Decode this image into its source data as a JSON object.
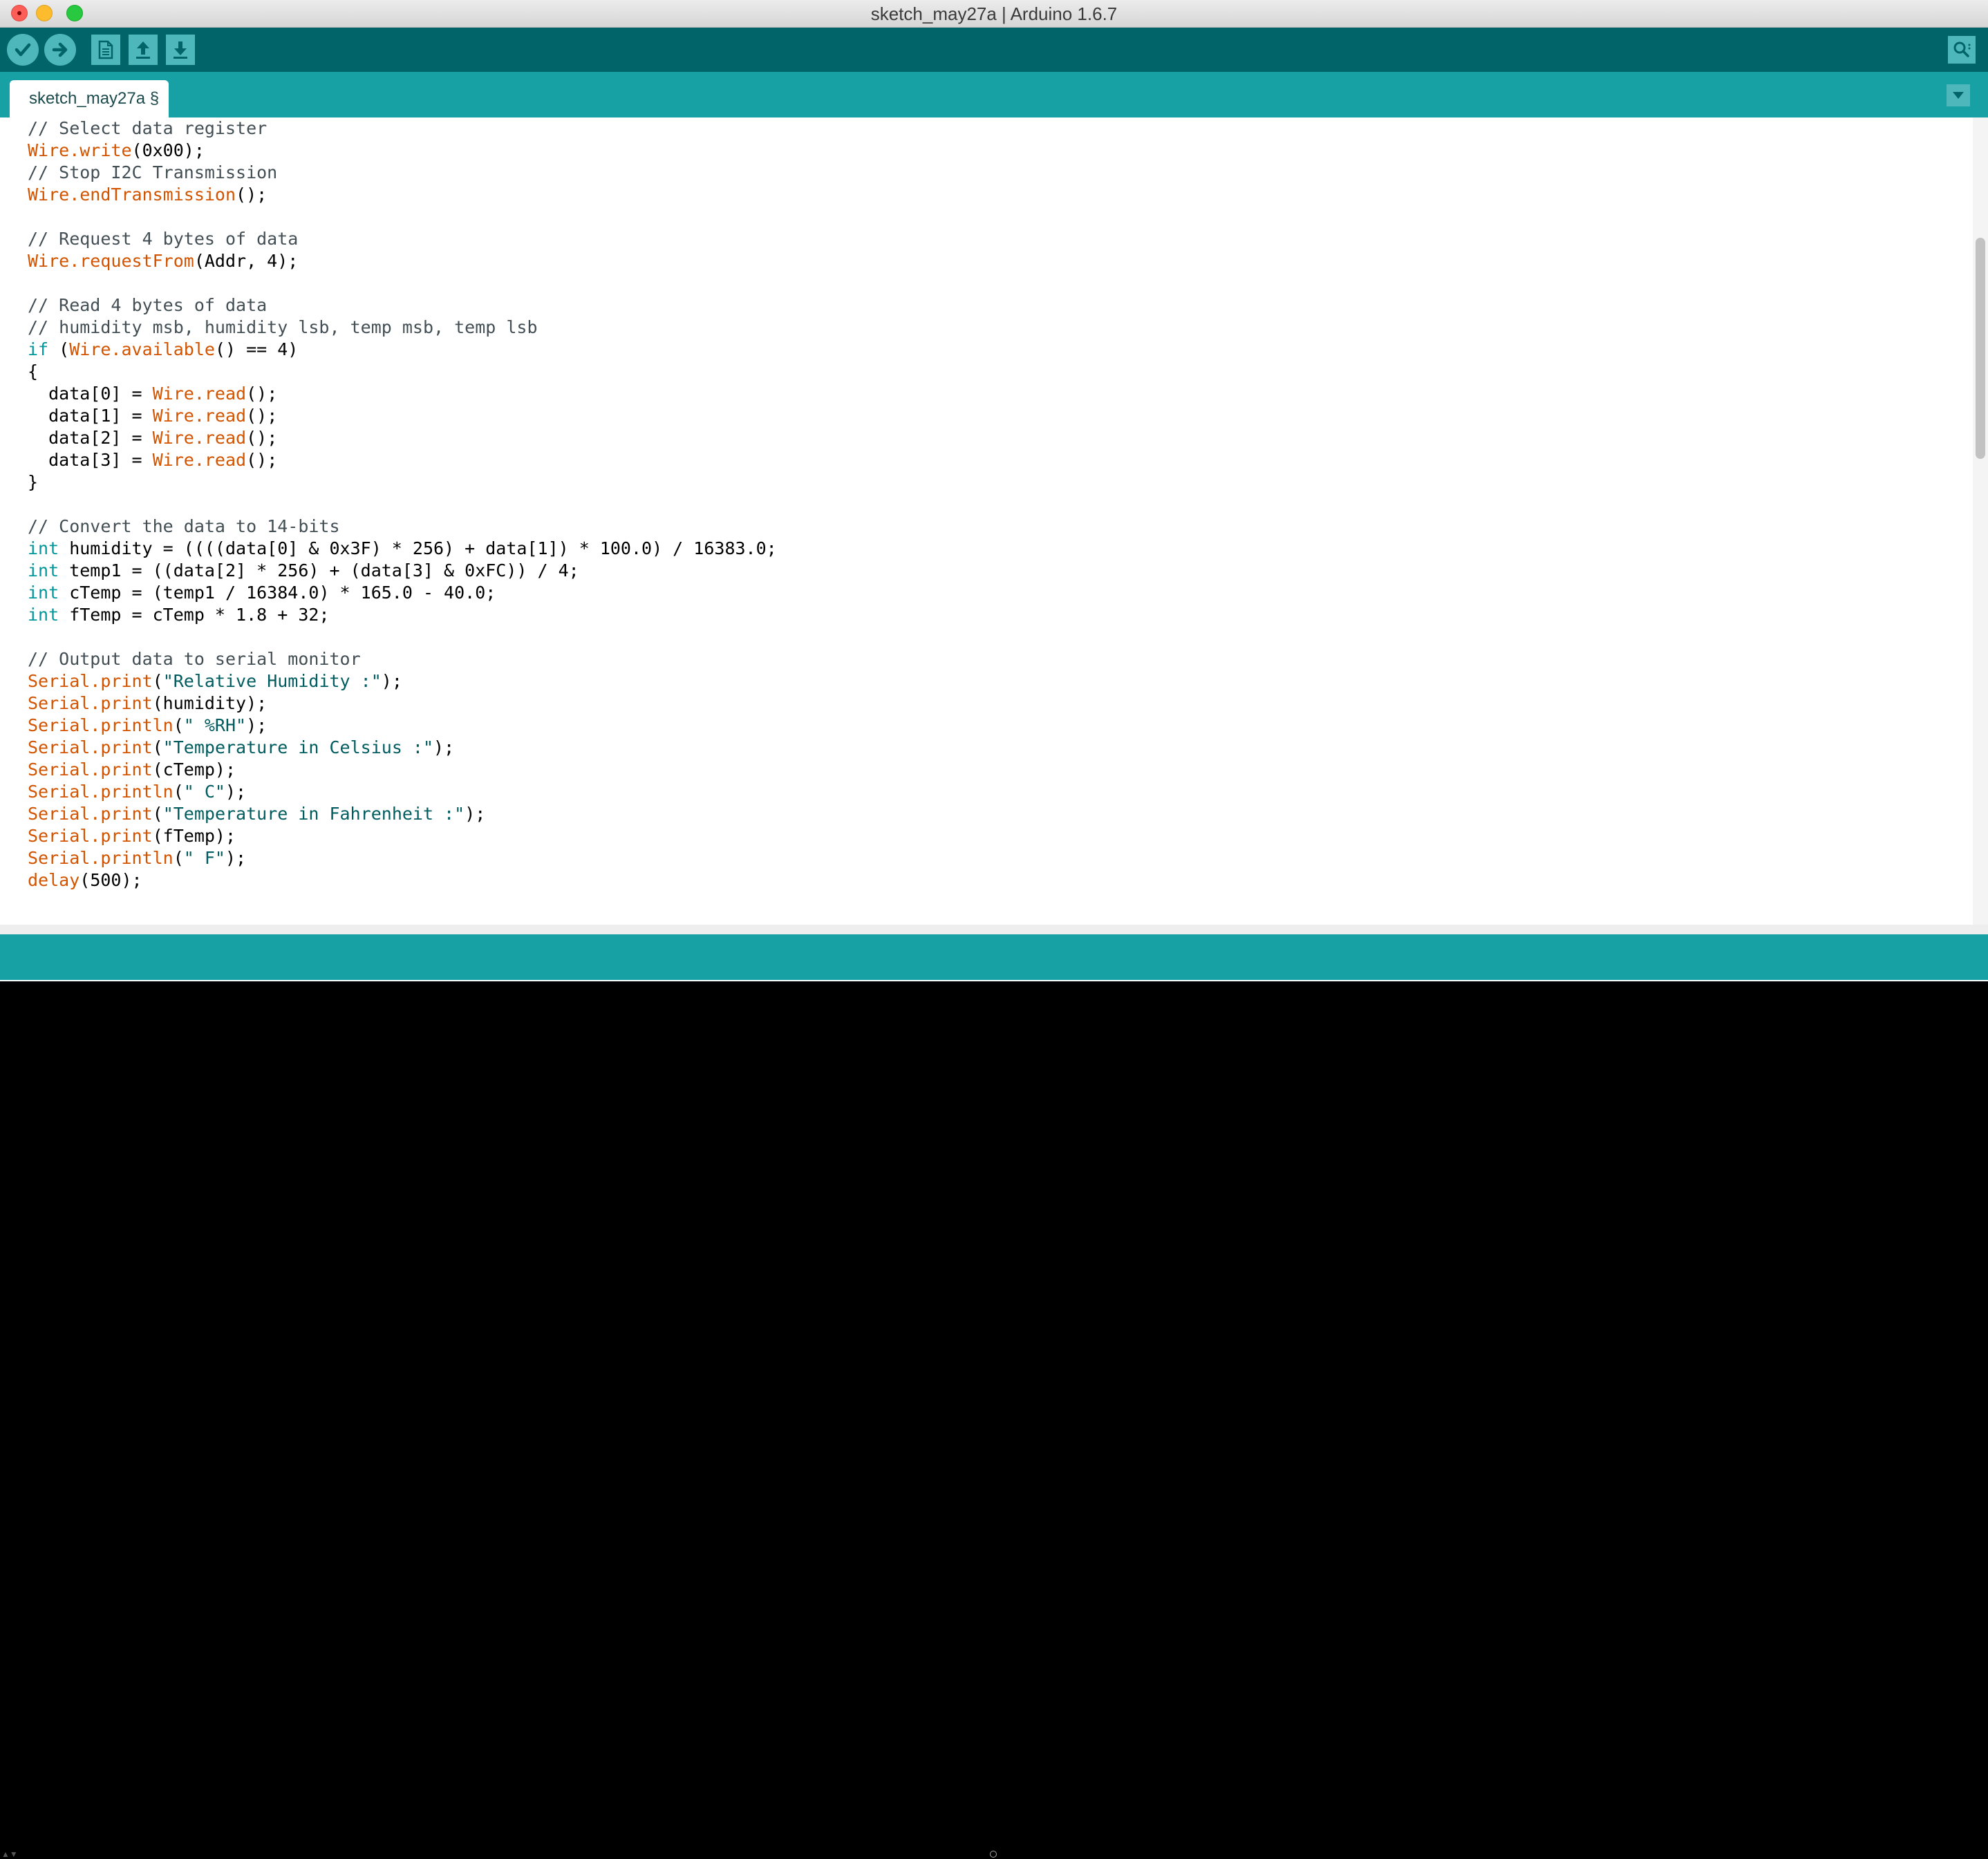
{
  "window": {
    "title": "sketch_may27a | Arduino 1.6.7"
  },
  "tabs": [
    {
      "label": "sketch_may27a §"
    }
  ],
  "toolbar": {
    "buttons": [
      {
        "name": "verify-button",
        "icon": "checkmark-icon"
      },
      {
        "name": "upload-button",
        "icon": "arrow-right-icon"
      },
      {
        "name": "new-button",
        "icon": "document-icon"
      },
      {
        "name": "open-button",
        "icon": "arrow-up-icon"
      },
      {
        "name": "save-button",
        "icon": "arrow-down-icon"
      }
    ],
    "serial_monitor_icon": "magnifier-icon"
  },
  "colors": {
    "toolbar": "#006468",
    "tabbar": "#17a1a5",
    "button": "#4db7bb",
    "comment": "#434f54",
    "function": "#d35400",
    "keyword": "#00979c",
    "string": "#005c5f"
  },
  "code": [
    [
      [
        "c",
        "// Select data register"
      ]
    ],
    [
      [
        "f",
        "Wire.write"
      ],
      [
        "p",
        "(0x00);"
      ]
    ],
    [
      [
        "c",
        "// Stop I2C Transmission"
      ]
    ],
    [
      [
        "f",
        "Wire.endTransmission"
      ],
      [
        "p",
        "();"
      ]
    ],
    [],
    [
      [
        "c",
        "// Request 4 bytes of data"
      ]
    ],
    [
      [
        "f",
        "Wire.requestFrom"
      ],
      [
        "p",
        "(Addr, 4);"
      ]
    ],
    [],
    [
      [
        "c",
        "// Read 4 bytes of data"
      ]
    ],
    [
      [
        "c",
        "// humidity msb, humidity lsb, temp msb, temp lsb"
      ]
    ],
    [
      [
        "k",
        "if"
      ],
      [
        "p",
        " ("
      ],
      [
        "f",
        "Wire.available"
      ],
      [
        "p",
        "() == 4)"
      ]
    ],
    [
      [
        "p",
        "{"
      ]
    ],
    [
      [
        "p",
        "  data[0] = "
      ],
      [
        "f",
        "Wire.read"
      ],
      [
        "p",
        "();"
      ]
    ],
    [
      [
        "p",
        "  data[1] = "
      ],
      [
        "f",
        "Wire.read"
      ],
      [
        "p",
        "();"
      ]
    ],
    [
      [
        "p",
        "  data[2] = "
      ],
      [
        "f",
        "Wire.read"
      ],
      [
        "p",
        "();"
      ]
    ],
    [
      [
        "p",
        "  data[3] = "
      ],
      [
        "f",
        "Wire.read"
      ],
      [
        "p",
        "();"
      ]
    ],
    [
      [
        "p",
        "}"
      ]
    ],
    [],
    [
      [
        "c",
        "// Convert the data to 14-bits"
      ]
    ],
    [
      [
        "k",
        "int"
      ],
      [
        "p",
        " humidity = ((((data[0] & 0x3F) * 256) + data[1]) * 100.0) / 16383.0;"
      ]
    ],
    [
      [
        "k",
        "int"
      ],
      [
        "p",
        " temp1 = ((data[2] * 256) + (data[3] & 0xFC)) / 4;"
      ]
    ],
    [
      [
        "k",
        "int"
      ],
      [
        "p",
        " cTemp = (temp1 / 16384.0) * 165.0 - 40.0;"
      ]
    ],
    [
      [
        "k",
        "int"
      ],
      [
        "p",
        " fTemp = cTemp * 1.8 + 32;"
      ]
    ],
    [],
    [
      [
        "c",
        "// Output data to serial monitor"
      ]
    ],
    [
      [
        "f",
        "Serial.print"
      ],
      [
        "p",
        "("
      ],
      [
        "s",
        "\"Relative Humidity :\""
      ],
      [
        "p",
        ");"
      ]
    ],
    [
      [
        "f",
        "Serial.print"
      ],
      [
        "p",
        "(humidity);"
      ]
    ],
    [
      [
        "f",
        "Serial.println"
      ],
      [
        "p",
        "("
      ],
      [
        "s",
        "\" %RH\""
      ],
      [
        "p",
        ");"
      ]
    ],
    [
      [
        "f",
        "Serial.print"
      ],
      [
        "p",
        "("
      ],
      [
        "s",
        "\"Temperature in Celsius :\""
      ],
      [
        "p",
        ");"
      ]
    ],
    [
      [
        "f",
        "Serial.print"
      ],
      [
        "p",
        "(cTemp);"
      ]
    ],
    [
      [
        "f",
        "Serial.println"
      ],
      [
        "p",
        "("
      ],
      [
        "s",
        "\" C\""
      ],
      [
        "p",
        ");"
      ]
    ],
    [
      [
        "f",
        "Serial.print"
      ],
      [
        "p",
        "("
      ],
      [
        "s",
        "\"Temperature in Fahrenheit :\""
      ],
      [
        "p",
        ");"
      ]
    ],
    [
      [
        "f",
        "Serial.print"
      ],
      [
        "p",
        "(fTemp);"
      ]
    ],
    [
      [
        "f",
        "Serial.println"
      ],
      [
        "p",
        "("
      ],
      [
        "s",
        "\" F\""
      ],
      [
        "p",
        ");"
      ]
    ],
    [
      [
        "f",
        "delay"
      ],
      [
        "p",
        "(500);"
      ]
    ]
  ]
}
